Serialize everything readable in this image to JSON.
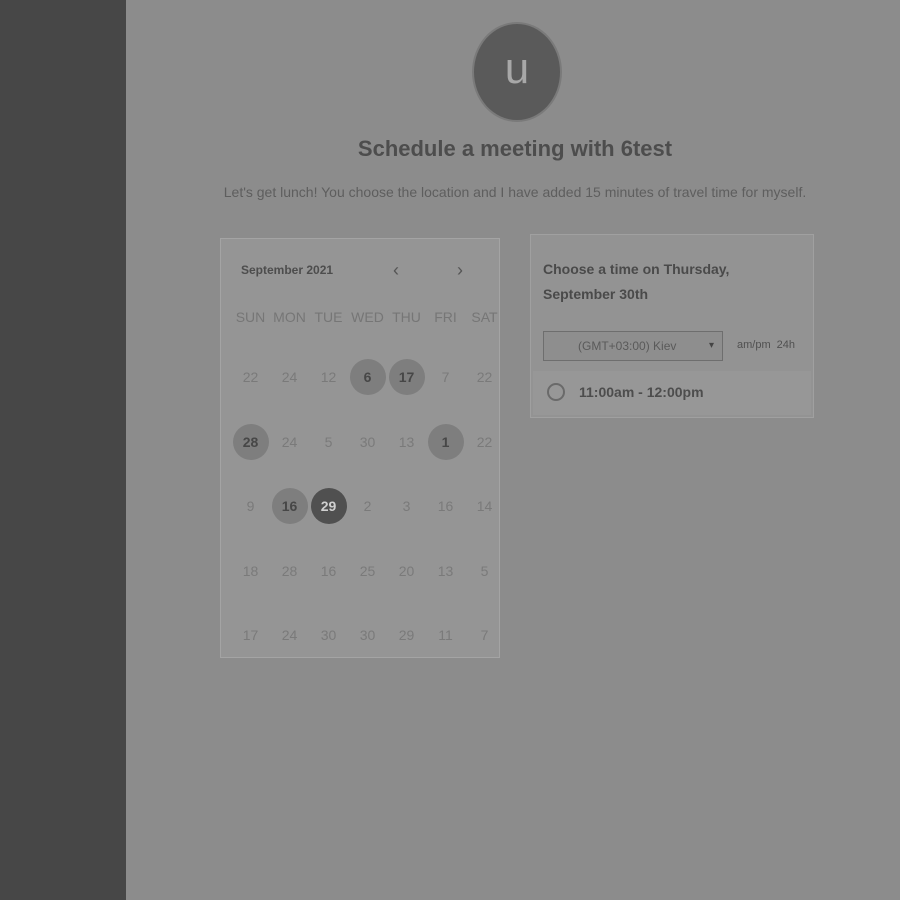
{
  "avatar": {
    "initial": "u"
  },
  "title": "Schedule a meeting with 6test",
  "description": "Let's get lunch! You choose the location and I have added 15 minutes of travel time for myself.",
  "calendar": {
    "month_label": "September 2021",
    "prev_icon": "‹",
    "next_icon": "›",
    "weekdays": [
      "SUN",
      "MON",
      "TUE",
      "WED",
      "THU",
      "FRI",
      "SAT"
    ],
    "days": [
      {
        "label": "22",
        "state": "disabled"
      },
      {
        "label": "24",
        "state": "disabled"
      },
      {
        "label": "12",
        "state": "disabled"
      },
      {
        "label": "6",
        "state": "available"
      },
      {
        "label": "17",
        "state": "available"
      },
      {
        "label": "7",
        "state": "disabled"
      },
      {
        "label": "22",
        "state": "disabled"
      },
      {
        "label": "28",
        "state": "available"
      },
      {
        "label": "24",
        "state": "disabled"
      },
      {
        "label": "5",
        "state": "disabled"
      },
      {
        "label": "30",
        "state": "disabled"
      },
      {
        "label": "13",
        "state": "disabled"
      },
      {
        "label": "1",
        "state": "available"
      },
      {
        "label": "22",
        "state": "disabled"
      },
      {
        "label": "9",
        "state": "disabled"
      },
      {
        "label": "16",
        "state": "available"
      },
      {
        "label": "29",
        "state": "selected"
      },
      {
        "label": "2",
        "state": "disabled"
      },
      {
        "label": "3",
        "state": "disabled"
      },
      {
        "label": "16",
        "state": "disabled"
      },
      {
        "label": "14",
        "state": "disabled"
      },
      {
        "label": "18",
        "state": "disabled"
      },
      {
        "label": "28",
        "state": "disabled"
      },
      {
        "label": "16",
        "state": "disabled"
      },
      {
        "label": "25",
        "state": "disabled"
      },
      {
        "label": "20",
        "state": "disabled"
      },
      {
        "label": "13",
        "state": "disabled"
      },
      {
        "label": "5",
        "state": "disabled"
      },
      {
        "label": "17",
        "state": "disabled"
      },
      {
        "label": "24",
        "state": "disabled"
      },
      {
        "label": "30",
        "state": "disabled"
      },
      {
        "label": "30",
        "state": "disabled"
      },
      {
        "label": "29",
        "state": "disabled"
      },
      {
        "label": "11",
        "state": "disabled"
      },
      {
        "label": "7",
        "state": "disabled"
      }
    ]
  },
  "time_picker": {
    "heading": "Choose a time on Thursday, September 30th",
    "timezone_value": "(GMT+03:00) Kiev",
    "caret_icon": "▾",
    "format_ampm": "am/pm",
    "format_24h": "24h",
    "slots": [
      {
        "label": "11:00am - 12:00pm"
      }
    ]
  }
}
